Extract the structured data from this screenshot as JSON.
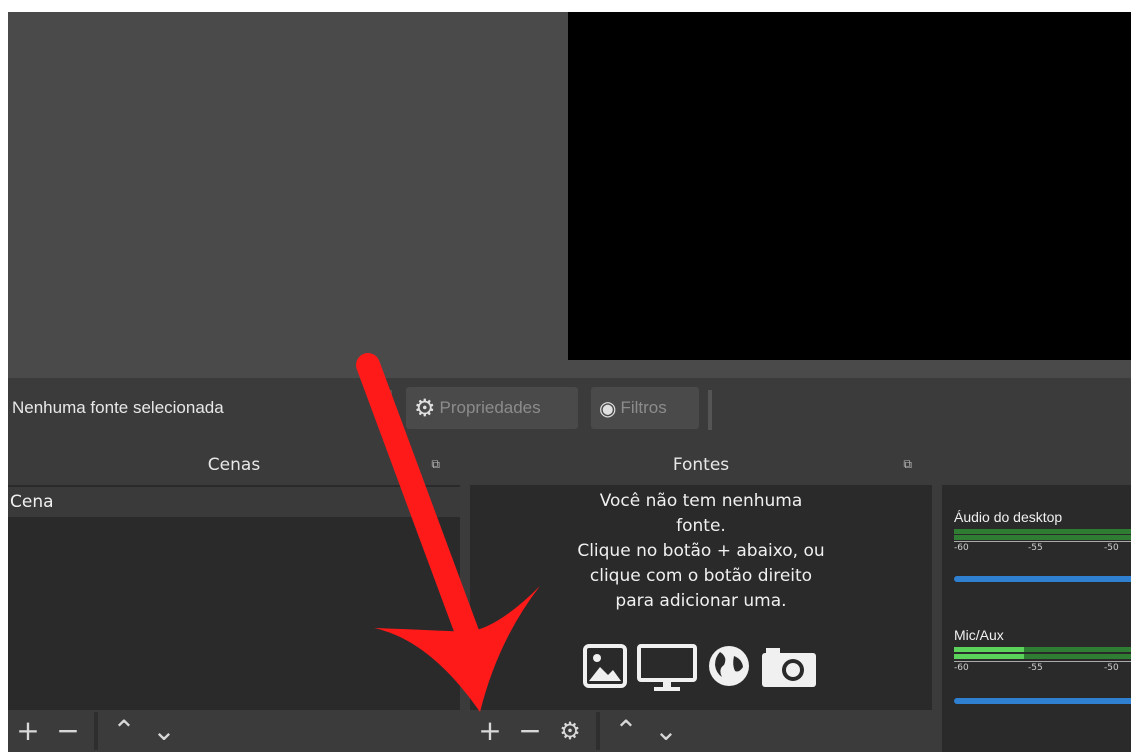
{
  "toolbar": {
    "no_source": "Nenhuma fonte selecionada",
    "properties": "Propriedades",
    "filters": "Filtros"
  },
  "scenes": {
    "title": "Cenas",
    "items": [
      "Cena"
    ]
  },
  "sources": {
    "title": "Fontes",
    "empty_lines": [
      "Você não tem nenhuma",
      "fonte.",
      "Clique no botão + abaixo, ou",
      "clique com o botão direito",
      "para adicionar uma."
    ]
  },
  "mixer": {
    "channels": [
      {
        "name": "Áudio do desktop",
        "scale": [
          "-60",
          "-55",
          "-50"
        ]
      },
      {
        "name": "Mic/Aux",
        "scale": [
          "-60",
          "-55",
          "-50"
        ]
      }
    ]
  },
  "colors": {
    "arrow": "#ff1a1a",
    "volume_bar": "#2f80d1",
    "meter": "#5bd35b"
  }
}
